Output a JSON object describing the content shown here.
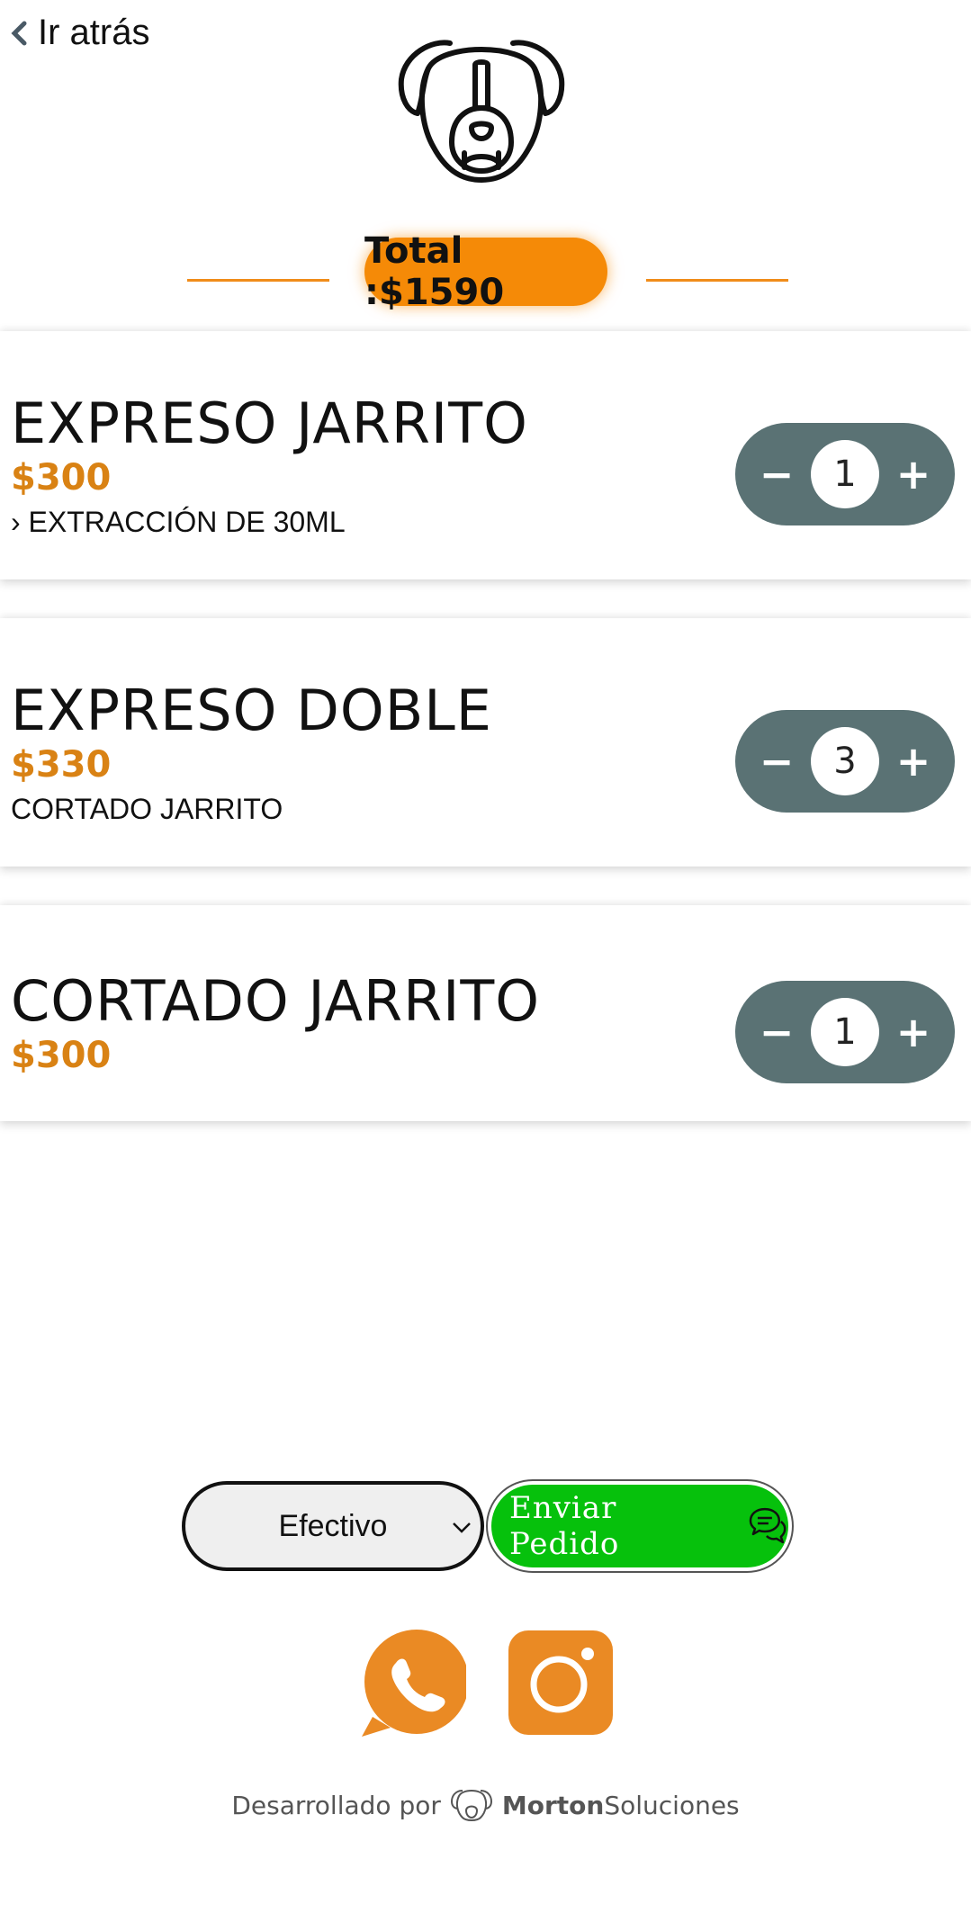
{
  "header": {
    "back_label": "Ir atrás",
    "total_label": "Total :$1590"
  },
  "items": [
    {
      "name": "EXPRESO JARRITO",
      "price": "$300",
      "desc": "› EXTRACCIÓN DE 30ML",
      "qty": "1"
    },
    {
      "name": "EXPRESO DOBLE",
      "price": "$330",
      "desc": "CORTADO JARRITO",
      "qty": "3"
    },
    {
      "name": "CORTADO JARRITO",
      "price": "$300",
      "desc": "",
      "qty": "1"
    }
  ],
  "stepper": {
    "minus": "−",
    "plus": "+"
  },
  "payment": {
    "selected": "Efectivo"
  },
  "send_button": {
    "label": "Enviar  Pedido"
  },
  "footer": {
    "prefix": "Desarrollado por",
    "brand_bold": "Morton",
    "brand_rest": "Soluciones"
  },
  "colors": {
    "accent": "#f58a07",
    "stepper": "#5a7274",
    "send": "#06c10c",
    "price": "#d98214"
  },
  "icons": [
    "chevron-left-icon",
    "dog-logo-icon",
    "chevron-down-icon",
    "chat-bubbles-icon",
    "whatsapp-icon",
    "instagram-icon"
  ]
}
